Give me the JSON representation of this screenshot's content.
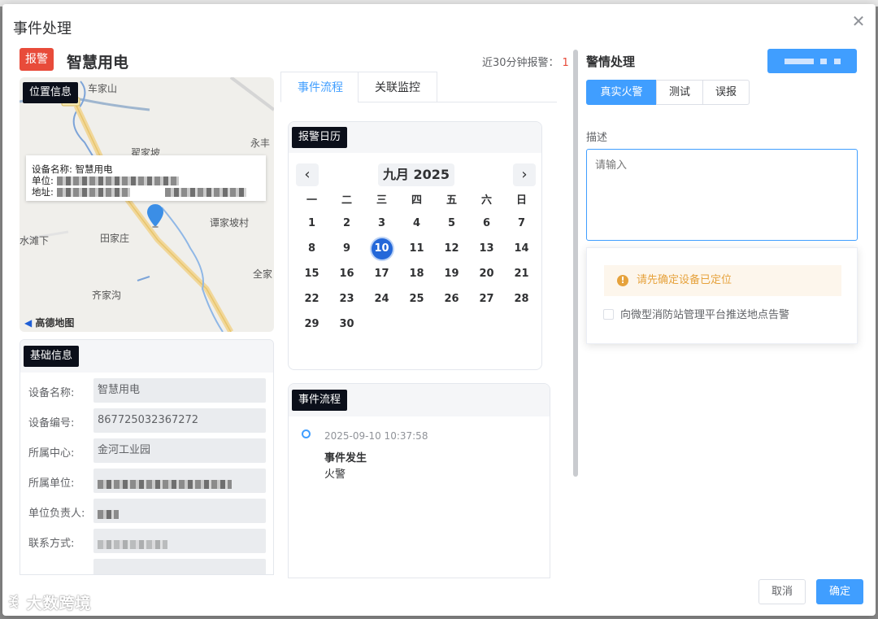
{
  "dialog": {
    "title": "事件处理",
    "close_icon": "close-icon",
    "alarm_badge": "报警",
    "device_title": "智慧用电",
    "recent_alarm_label": "近30分钟报警：",
    "recent_alarm_count": "1",
    "colors": {
      "primary": "#409eff",
      "danger": "#e84b3a",
      "warning": "#e6a23c"
    }
  },
  "map": {
    "tag": "位置信息",
    "places": [
      "车家山",
      "翟家坡",
      "永丰",
      "谭家坡村",
      "田家庄",
      "水滩下",
      "全家",
      "齐家沟"
    ],
    "info_device": "设备名称: 智慧用电",
    "info_unit": "单位:",
    "info_address": "地址:",
    "logo": "高德地图"
  },
  "basic": {
    "tag": "基础信息",
    "rows": [
      {
        "label": "设备名称:",
        "value": "智慧用电"
      },
      {
        "label": "设备编号:",
        "value": "867725032367272"
      },
      {
        "label": "所属中心:",
        "value": "金河工业园"
      },
      {
        "label": "所属单位:",
        "value": ""
      },
      {
        "label": "单位负责人:",
        "value": ""
      },
      {
        "label": "联系方式:",
        "value": ""
      }
    ]
  },
  "tabs": [
    {
      "label": "事件流程",
      "active": true
    },
    {
      "label": "关联监控",
      "active": false
    }
  ],
  "calendar": {
    "tag": "报警日历",
    "month": "九月 2025",
    "weekdays": [
      "一",
      "二",
      "三",
      "四",
      "五",
      "六",
      "日"
    ],
    "weeks": [
      [
        "1",
        "2",
        "3",
        "4",
        "5",
        "6",
        "7"
      ],
      [
        "8",
        "9",
        "10",
        "11",
        "12",
        "13",
        "14"
      ],
      [
        "15",
        "16",
        "17",
        "18",
        "19",
        "20",
        "21"
      ],
      [
        "22",
        "23",
        "24",
        "25",
        "26",
        "27",
        "28"
      ],
      [
        "29",
        "30",
        "",
        "",
        "",
        "",
        ""
      ]
    ],
    "today": "10"
  },
  "flow": {
    "tag": "事件流程",
    "time": "2025-09-10 10:37:58",
    "title": "事件发生",
    "desc": "火警"
  },
  "handling": {
    "title": "警情处理",
    "segments": [
      {
        "label": "真实火警",
        "active": true
      },
      {
        "label": "测试",
        "active": false
      },
      {
        "label": "误报",
        "active": false
      }
    ],
    "desc_label": "描述",
    "desc_placeholder": "请输入",
    "warning": "请先确定设备已定位",
    "checkbox_label": "向微型消防站管理平台推送地点告警"
  },
  "footer": {
    "cancel": "取消",
    "confirm": "确定"
  },
  "watermark": "大数跨境"
}
